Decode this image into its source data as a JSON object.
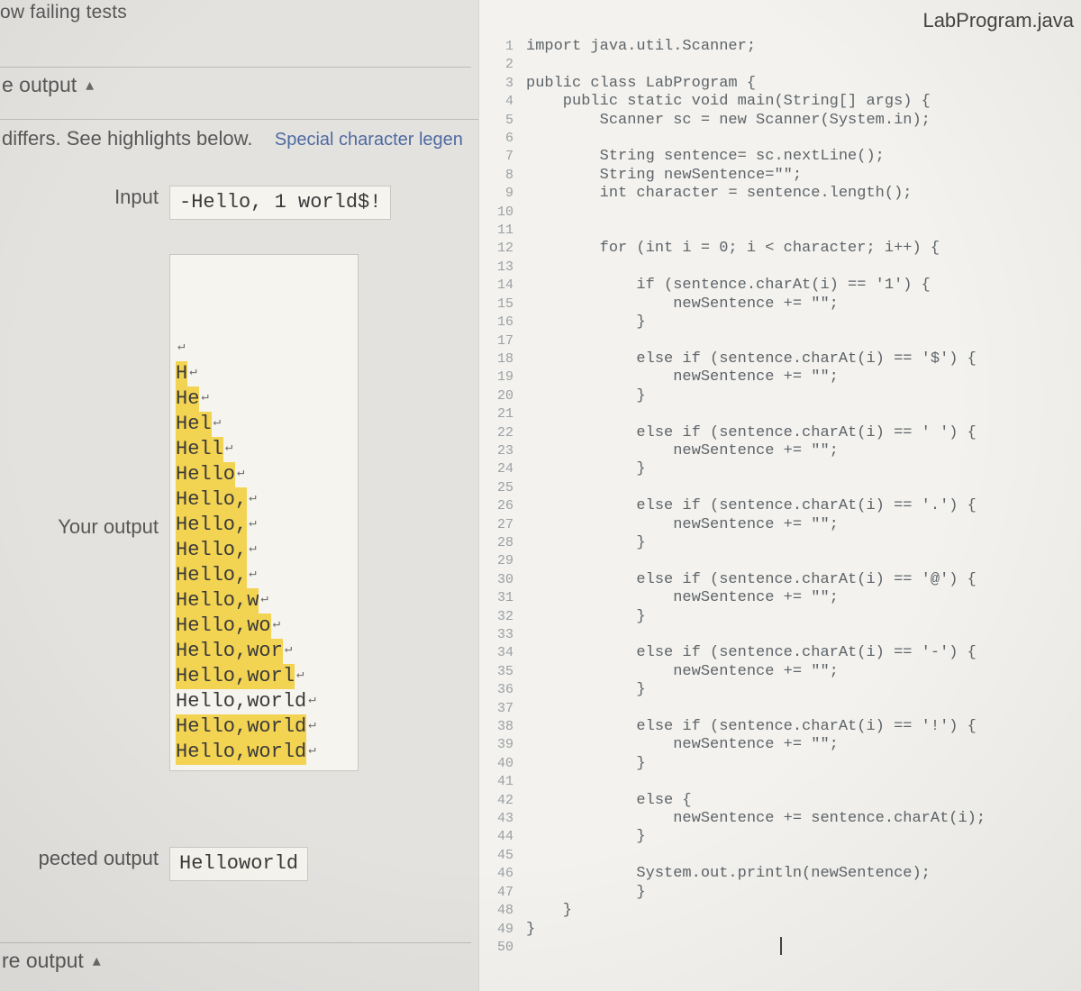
{
  "file_title": "LabProgram.java",
  "top_cut": "ow failing tests",
  "sections": {
    "output_label": "e output",
    "differs_text": "differs. See highlights below.",
    "legend_link": "Special character legen",
    "compare_output_label": "re output"
  },
  "kv": {
    "input_label": "Input",
    "input_value": "-Hello, 1 world$!",
    "your_output_label": "Your output",
    "expected_label": "pected output",
    "expected_value": "Helloworld"
  },
  "your_output_lines": [
    {
      "hl": "",
      "plain": ""
    },
    {
      "hl": "H",
      "plain": ""
    },
    {
      "hl": "He",
      "plain": ""
    },
    {
      "hl": "Hel",
      "plain": ""
    },
    {
      "hl": "Hell",
      "plain": ""
    },
    {
      "hl": "Hello",
      "plain": ""
    },
    {
      "hl": "Hello,",
      "plain": ""
    },
    {
      "hl": "Hello,",
      "plain": ""
    },
    {
      "hl": "Hello,",
      "plain": ""
    },
    {
      "hl": "Hello,",
      "plain": ""
    },
    {
      "hl": "Hello,w",
      "plain": ""
    },
    {
      "hl": "Hello,wo",
      "plain": ""
    },
    {
      "hl": "Hello,wor",
      "plain": ""
    },
    {
      "hl": "Hello,worl",
      "plain": ""
    },
    {
      "hl": "",
      "plain": "Hello,world"
    },
    {
      "hl": "Hello,world",
      "plain": ""
    },
    {
      "hl": "Hello,world",
      "plain": ""
    }
  ],
  "code": {
    "lines": [
      "import java.util.Scanner;",
      "",
      "public class LabProgram {",
      "    public static void main(String[] args) {",
      "        Scanner sc = new Scanner(System.in);",
      "",
      "        String sentence= sc.nextLine();",
      "        String newSentence=\"\";",
      "        int character = sentence.length();",
      "",
      "",
      "        for (int i = 0; i < character; i++) {",
      "",
      "            if (sentence.charAt(i) == '1') {",
      "                newSentence += \"\";",
      "            }",
      "",
      "            else if (sentence.charAt(i) == '$') {",
      "                newSentence += \"\";",
      "            }",
      "",
      "            else if (sentence.charAt(i) == ' ') {",
      "                newSentence += \"\";",
      "            }",
      "",
      "            else if (sentence.charAt(i) == '.') {",
      "                newSentence += \"\";",
      "            }",
      "",
      "            else if (sentence.charAt(i) == '@') {",
      "                newSentence += \"\";",
      "            }",
      "",
      "            else if (sentence.charAt(i) == '-') {",
      "                newSentence += \"\";",
      "            }",
      "",
      "            else if (sentence.charAt(i) == '!') {",
      "                newSentence += \"\";",
      "            }",
      "",
      "            else {",
      "                newSentence += sentence.charAt(i);",
      "            }",
      "",
      "            System.out.println(newSentence);",
      "            }",
      "    }",
      "}",
      ""
    ]
  }
}
